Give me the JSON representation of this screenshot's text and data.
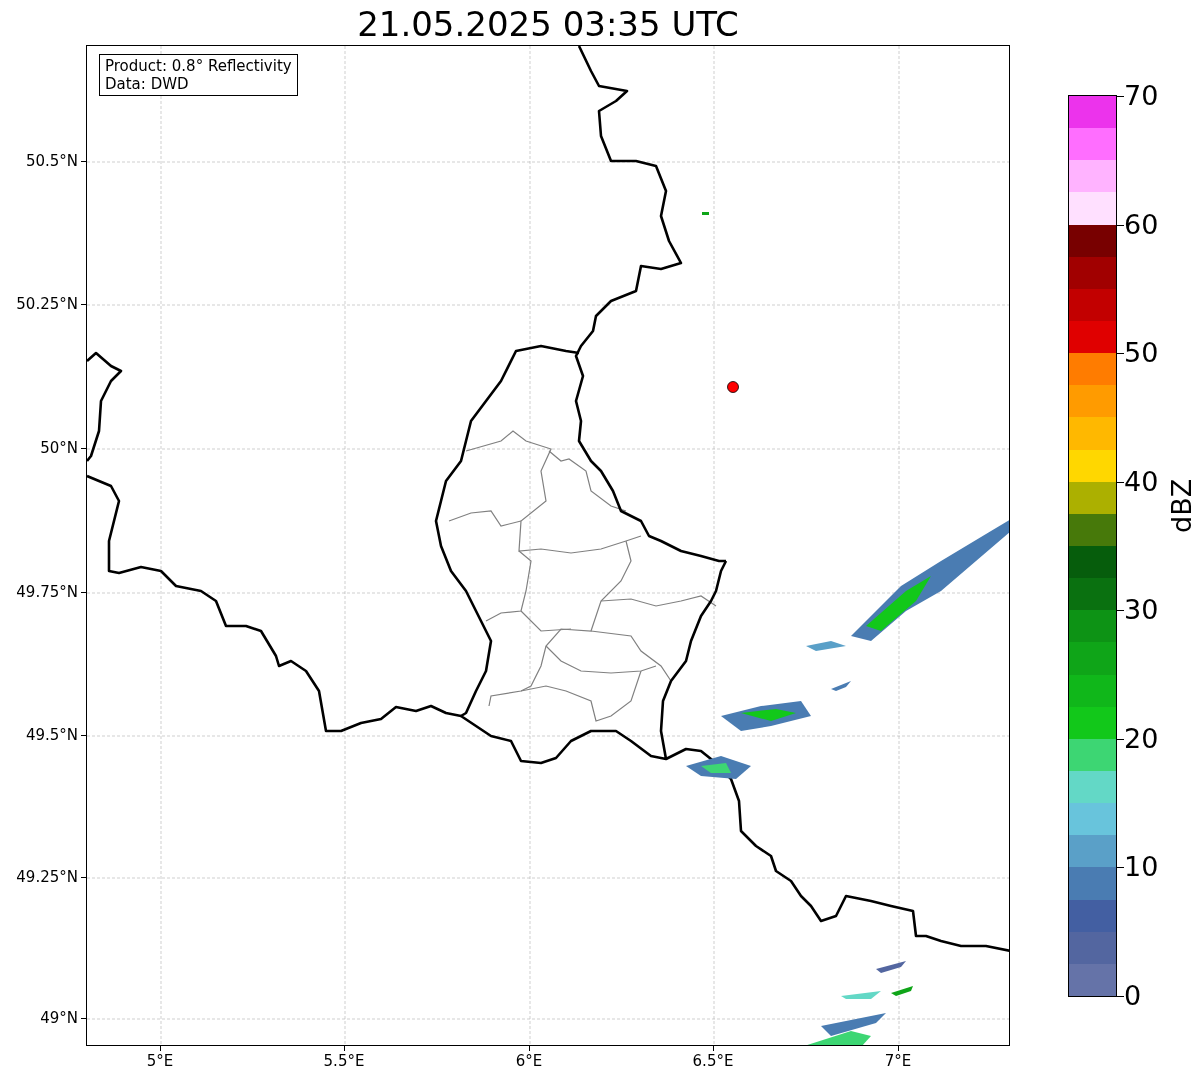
{
  "title": "21.05.2025 03:35 UTC",
  "legend": {
    "lines": [
      "Product: 0.8° Reflectivity",
      "Data: DWD"
    ]
  },
  "map": {
    "xticks": [
      "5°E",
      "5.5°E",
      "6°E",
      "6.5°E",
      "7°E"
    ],
    "yticks": [
      "50.5°N",
      "50.25°N",
      "50°N",
      "49.75°N",
      "49.5°N",
      "49.25°N",
      "49°N"
    ]
  },
  "colorbar": {
    "label": "dBZ",
    "ticks": [
      "70",
      "60",
      "50",
      "40",
      "30",
      "20",
      "10",
      "0"
    ],
    "bands": [
      {
        "color": "#6573a8"
      },
      {
        "color": "#5366a0"
      },
      {
        "color": "#435fa2"
      },
      {
        "color": "#4a7cb2"
      },
      {
        "color": "#5aa0c8"
      },
      {
        "color": "#68c4dc"
      },
      {
        "color": "#63d8c6"
      },
      {
        "color": "#3dd673"
      },
      {
        "color": "#12c81a"
      },
      {
        "color": "#10b71a"
      },
      {
        "color": "#0fa518"
      },
      {
        "color": "#0d9315"
      },
      {
        "color": "#0a7110"
      },
      {
        "color": "#065d0c"
      },
      {
        "color": "#47790a"
      },
      {
        "color": "#acb000"
      },
      {
        "color": "#ffd700"
      },
      {
        "color": "#ffb800"
      },
      {
        "color": "#ff9b00"
      },
      {
        "color": "#ff7c00"
      },
      {
        "color": "#e00000"
      },
      {
        "color": "#c20000"
      },
      {
        "color": "#a10000"
      },
      {
        "color": "#780000"
      },
      {
        "color": "#ffe0ff"
      },
      {
        "color": "#ffb3ff"
      },
      {
        "color": "#ff6eff"
      },
      {
        "color": "#ec33ec"
      }
    ]
  }
}
